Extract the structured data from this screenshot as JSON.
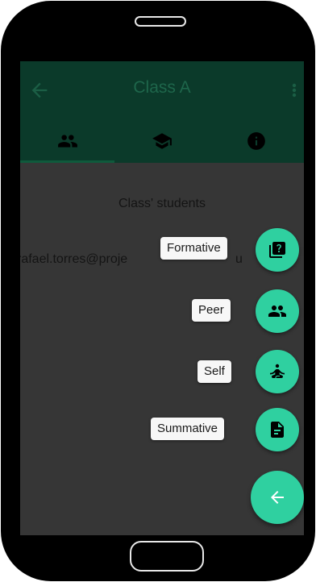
{
  "appbar": {
    "title": "Class A",
    "colors": {
      "background": "#0b3a2a",
      "title": "#1e664b",
      "icons": "#1b5e45"
    }
  },
  "tabs": [
    {
      "name": "students",
      "icon": "people-icon"
    },
    {
      "name": "teachers",
      "icon": "graduation-cap-icon"
    },
    {
      "name": "info",
      "icon": "info-icon"
    }
  ],
  "content": {
    "title": "Class' students",
    "students": [
      "rafael.torres@proje"
    ],
    "email_tail": "u"
  },
  "speed_dial": {
    "accent": "#2fd0a0",
    "items": [
      {
        "label": "Formative",
        "icon": "quiz-icon"
      },
      {
        "label": "Peer",
        "icon": "people-icon"
      },
      {
        "label": "Self",
        "icon": "self-meditation-icon"
      },
      {
        "label": "Summative",
        "icon": "document-icon"
      }
    ],
    "main_icon": "arrow-left-icon"
  }
}
